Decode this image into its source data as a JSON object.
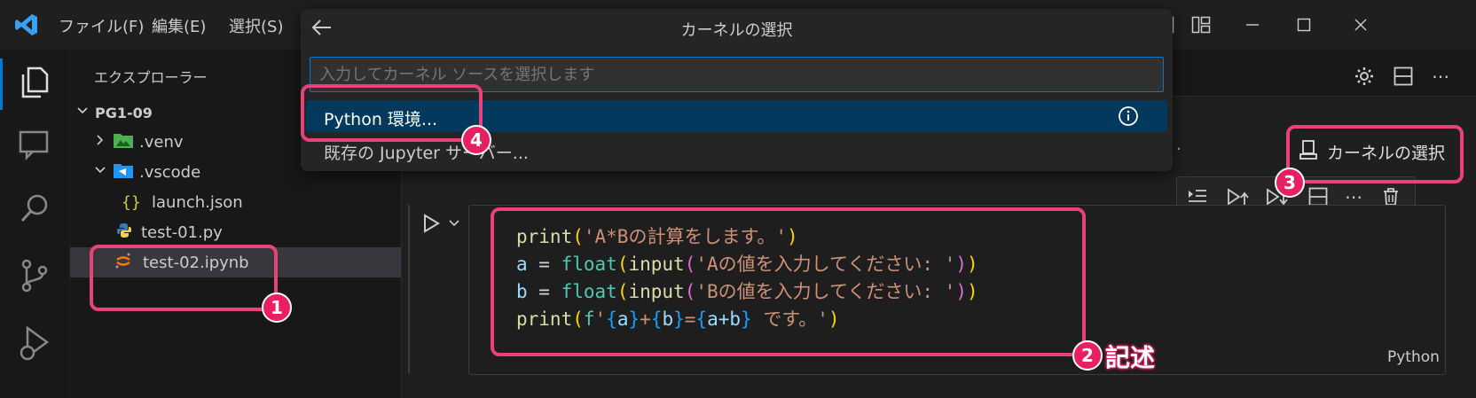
{
  "titlebar": {
    "menus": [
      "ファイル(F)",
      "編集(E)",
      "選択(S)"
    ]
  },
  "quickpick": {
    "title": "カーネルの選択",
    "placeholder": "入力してカーネル ソースを選択します",
    "items": [
      {
        "label": "Python 環境..."
      },
      {
        "label": "既存の Jupyter サーバー..."
      }
    ]
  },
  "explorer": {
    "title": "エクスプローラー",
    "root": "PG1-09",
    "items": [
      {
        "label": ".venv"
      },
      {
        "label": ".vscode"
      },
      {
        "label": "launch.json"
      },
      {
        "label": "test-01.py"
      },
      {
        "label": "test-02.ipynb"
      }
    ]
  },
  "editor": {
    "kernel_button": "カーネルの選択",
    "language": "Python",
    "code": {
      "l1": {
        "fn": "print",
        "s": "'A*Bの計算をします。'"
      },
      "l2": {
        "v": "a",
        "eq": " = ",
        "fn1": "float",
        "fn2": "input",
        "s": "'Aの値を入力してください: '"
      },
      "l3": {
        "v": "b",
        "eq": " = ",
        "fn1": "float",
        "fn2": "input",
        "s": "'Bの値を入力してください: '"
      },
      "l4": {
        "fn": "print",
        "f": "f",
        "q1": "'",
        "a": "a",
        "plus": "+",
        "b": "b",
        "eq": "=",
        "ab": "a+b",
        "tail": " です。'"
      }
    }
  },
  "annotations": {
    "badge1": "1",
    "badge2": "2",
    "badge2_text": "記述",
    "badge3": "3",
    "badge4": "4"
  },
  "colors": {
    "accent": "#0078d4",
    "selection": "#04395e",
    "highlight": "#ec407a"
  }
}
